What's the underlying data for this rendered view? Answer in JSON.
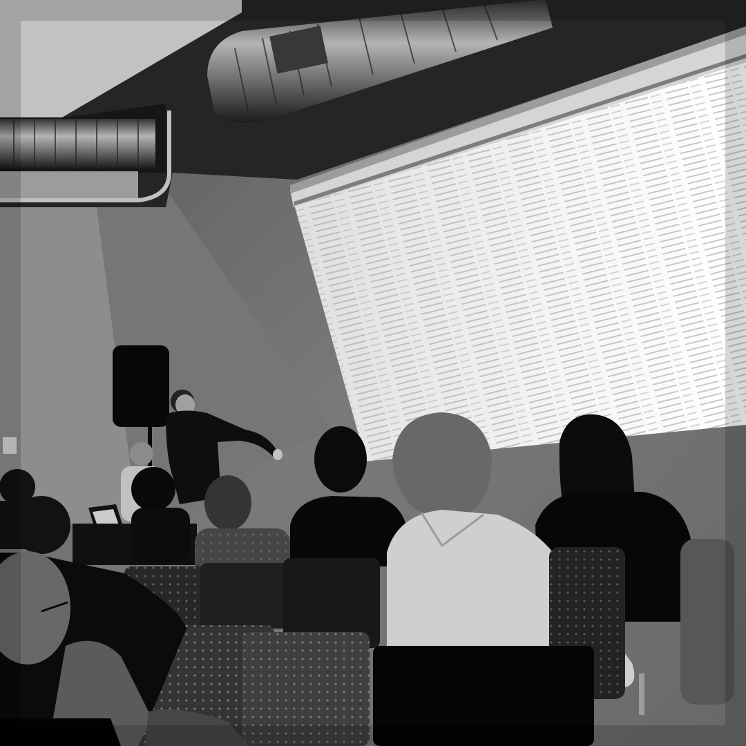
{
  "scene": {
    "caption": "",
    "colors": {
      "wall": "#6e6e6e",
      "wall_light": "#8a8a8a",
      "ceiling": "#2a2a2a",
      "screen": "#e9e9e9",
      "dark": "#141414",
      "shirt_light": "#c8c8c8"
    }
  }
}
